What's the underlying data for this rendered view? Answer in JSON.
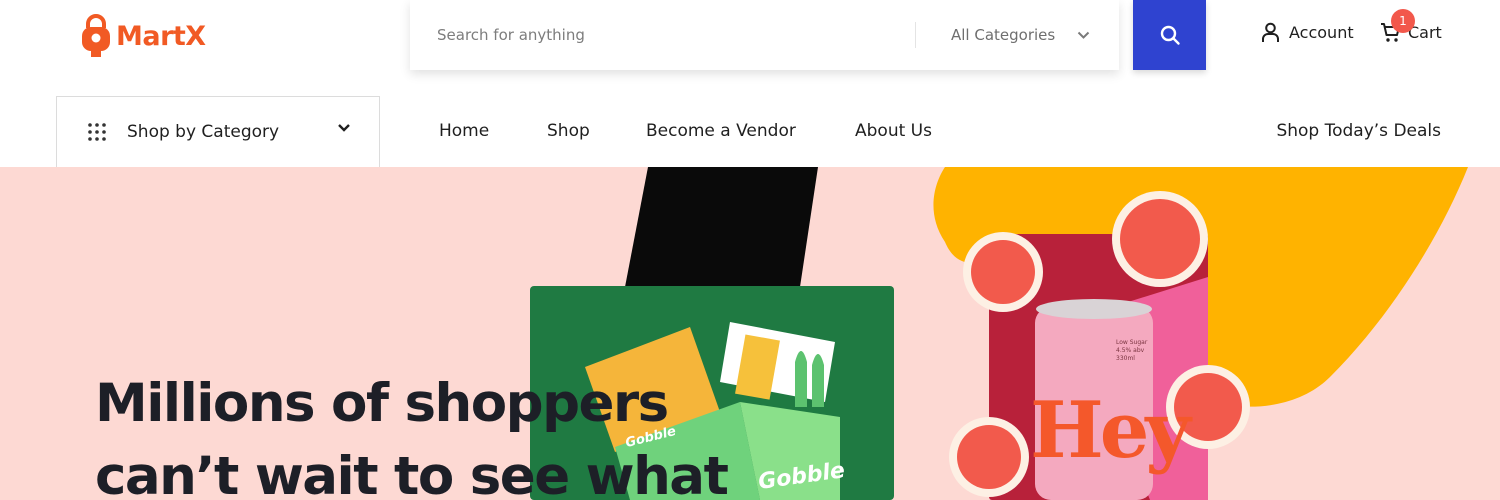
{
  "brand": {
    "name": "MartX",
    "color": "#f15a24",
    "icon": "shopping-bag-icon"
  },
  "search": {
    "placeholder": "Search for anything",
    "category": "All Categories",
    "button_icon": "search-icon",
    "button_color": "#2f43d0"
  },
  "header": {
    "account_label": "Account",
    "cart_label": "Cart",
    "cart_count": "1"
  },
  "nav": {
    "category_button": "Shop by Category",
    "links": [
      "Home",
      "Shop",
      "Become a Vendor",
      "About Us"
    ],
    "deals": "Shop Today’s Deals"
  },
  "hero": {
    "background": "#fdd9d3",
    "title_line1": "Millions of shoppers",
    "title_line2": "can’t wait to see what",
    "product1_brand": "Gobble",
    "product2_brand": "Hey",
    "can_text_1": "Low Sugar",
    "can_text_2": "4.5% abv",
    "can_text_3": "330ml"
  }
}
